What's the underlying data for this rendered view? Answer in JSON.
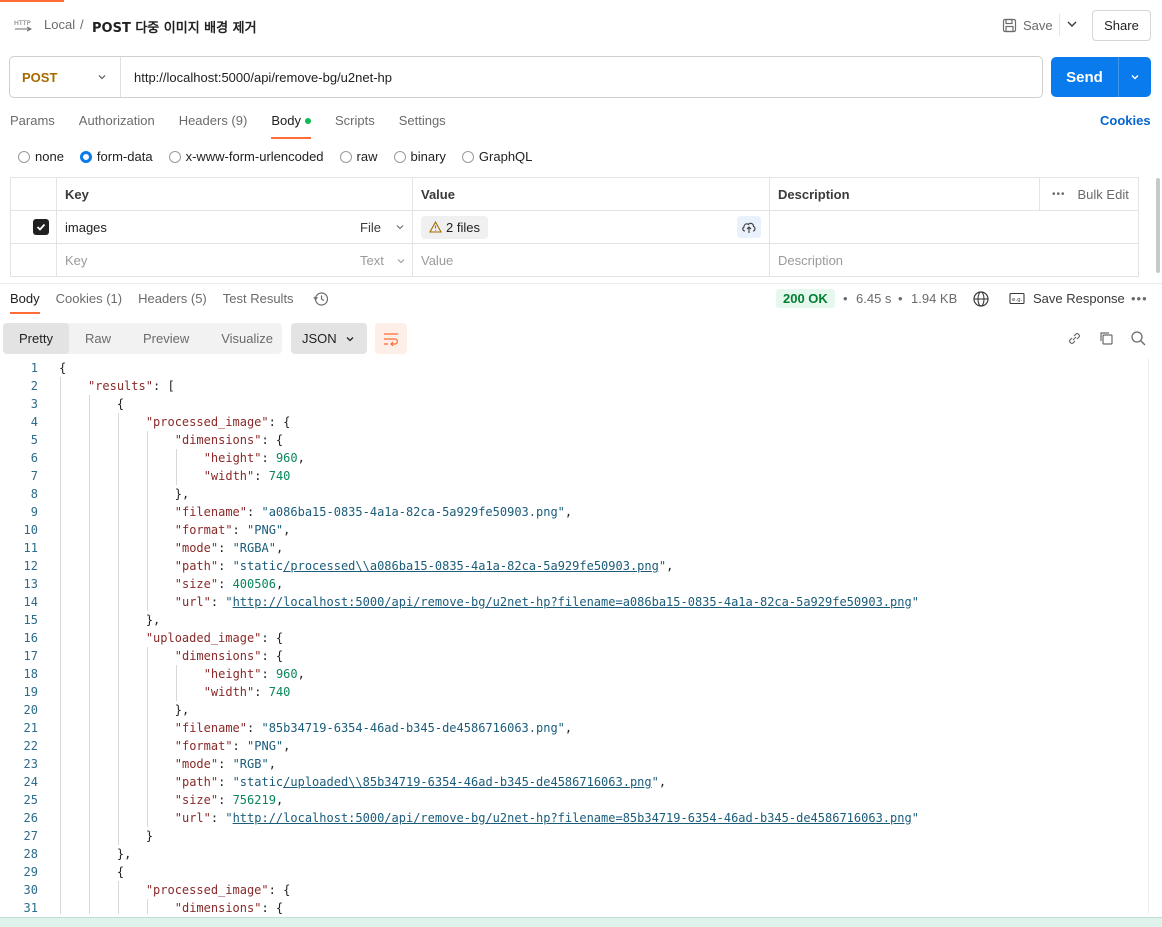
{
  "header": {
    "breadcrumb_local": "Local",
    "breadcrumb_sep": "/",
    "request_title": "POST 다중 이미지 배경 제거",
    "save_label": "Save",
    "share_label": "Share"
  },
  "request": {
    "method": "POST",
    "url": "http://localhost:5000/api/remove-bg/u2net-hp",
    "send_label": "Send"
  },
  "request_tabs": [
    "Params",
    "Authorization",
    "Headers (9)",
    "Body",
    "Scripts",
    "Settings"
  ],
  "cookies_label": "Cookies",
  "body_types": [
    "none",
    "form-data",
    "x-www-form-urlencoded",
    "raw",
    "binary",
    "GraphQL"
  ],
  "form_table": {
    "headers": [
      "Key",
      "Value",
      "Description"
    ],
    "bulk_edit": "Bulk Edit",
    "row": {
      "key": "images",
      "type": "File",
      "value": "2 files"
    },
    "empty_row": {
      "key_placeholder": "Key",
      "type": "Text",
      "value_placeholder": "Value",
      "description_placeholder": "Description"
    }
  },
  "response": {
    "tabs": [
      "Body",
      "Cookies (1)",
      "Headers (5)",
      "Test Results"
    ],
    "status": "200 OK",
    "time": "6.45 s",
    "size": "1.94 KB",
    "save_response": "Save Response",
    "view_tabs": [
      "Pretty",
      "Raw",
      "Preview",
      "Visualize"
    ],
    "format": "JSON"
  },
  "code_lines": [
    "{",
    "    \"results\": [",
    "        {",
    "            \"processed_image\": {",
    "                \"dimensions\": {",
    "                    \"height\": 960,",
    "                    \"width\": 740",
    "                },",
    "                \"filename\": \"a086ba15-0835-4a1a-82ca-5a929fe50903.png\",",
    "                \"format\": \"PNG\",",
    "                \"mode\": \"RGBA\",",
    "                \"path\": \"static/processed\\\\a086ba15-0835-4a1a-82ca-5a929fe50903.png\",",
    "                \"size\": 400506,",
    "                \"url\": \"http://localhost:5000/api/remove-bg/u2net-hp?filename=a086ba15-0835-4a1a-82ca-5a929fe50903.png\"",
    "            },",
    "            \"uploaded_image\": {",
    "                \"dimensions\": {",
    "                    \"height\": 960,",
    "                    \"width\": 740",
    "                },",
    "                \"filename\": \"85b34719-6354-46ad-b345-de4586716063.png\",",
    "                \"format\": \"PNG\",",
    "                \"mode\": \"RGB\",",
    "                \"path\": \"static/uploaded\\\\85b34719-6354-46ad-b345-de4586716063.png\",",
    "                \"size\": 756219,",
    "                \"url\": \"http://localhost:5000/api/remove-bg/u2net-hp?filename=85b34719-6354-46ad-b345-de4586716063.png\"",
    "            }",
    "        },",
    "        {",
    "            \"processed_image\": {",
    "                \"dimensions\": {"
  ],
  "colors": {
    "accent": "#ff6c37",
    "send": "#097bed",
    "status_ok": "#007f31",
    "method": "#a66a00"
  }
}
